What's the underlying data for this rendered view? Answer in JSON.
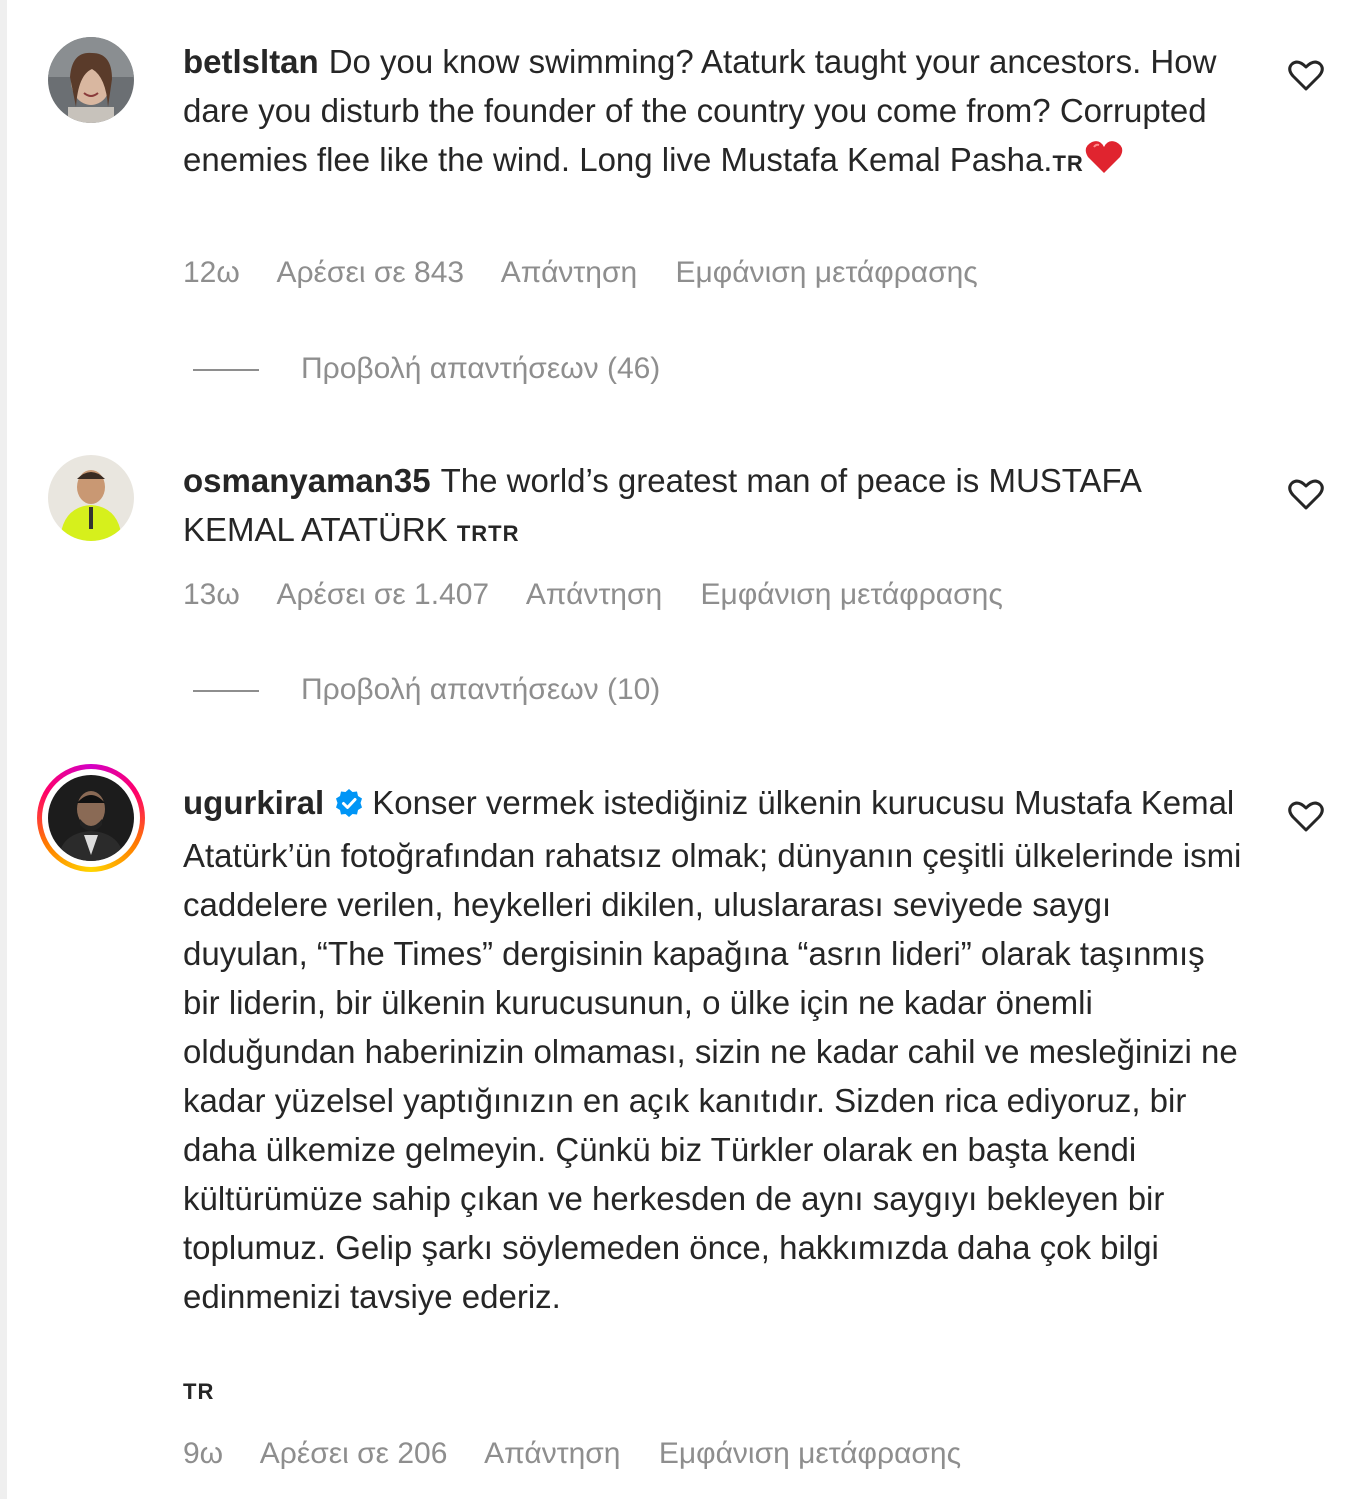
{
  "comments": [
    {
      "username": "betlsltan",
      "text": "Do you know swimming? Ataturk taught your ancestors. How dare you disturb the founder of the country you come from? Corrupted enemies flee like the wind. Long live Mustafa Kemal Pasha.",
      "flag": "TR",
      "emoji": "red-heart-icon",
      "time": "12ω",
      "likes": "Αρέσει σε 843",
      "reply": "Απάντηση",
      "translate": "Εμφάνιση μετάφρασης",
      "view_replies": "Προβολή απαντήσεων (46)"
    },
    {
      "username": "osmanyaman35",
      "text": "The world’s greatest man of peace is MUSTAFA KEMAL ATATÜRK",
      "flag": "TRTR",
      "time": "13ω",
      "likes": "Αρέσει σε 1.407",
      "reply": "Απάντηση",
      "translate": "Εμφάνιση μετάφρασης",
      "view_replies": "Προβολή απαντήσεων (10)"
    },
    {
      "username": "ugurkiral",
      "verified": true,
      "text": "Konser vermek istediğiniz ülkenin kurucusu Mustafa Kemal Atatürk’ün fotoğrafından rahatsız olmak; dünyanın çeşitli ülkelerinde ismi caddelere verilen, heykelleri dikilen, uluslararası seviyede saygı duyulan, “The Times” dergisinin kapağına “asrın lideri” olarak taşınmış bir liderin, bir ülkenin kurucusunun, o ülke için ne kadar önemli olduğundan haberinizin olmaması, sizin ne kadar cahil ve mesleğinizi ne kadar yüzelsel yaptığınızın en açık kanıtıdır. Sizden rica ediyoruz, bir daha ülkemize gelmeyin. Çünkü biz Türkler olarak en başta kendi kültürümüze sahip çıkan ve herkesden de aynı saygıyı bekleyen bir toplumuz. Gelip şarkı söylemeden önce, hakkımızda daha çok bilgi edinmenizi tavsiye ederiz.",
      "flag": "TR",
      "time": "9ω",
      "likes": "Αρέσει σε 206",
      "reply": "Απάντηση",
      "translate": "Εμφάνιση μετάφρασης"
    }
  ],
  "colors": {
    "text": "#262626",
    "muted": "#8e8e8e",
    "verified": "#0095f6",
    "heart": "#ed4956"
  }
}
